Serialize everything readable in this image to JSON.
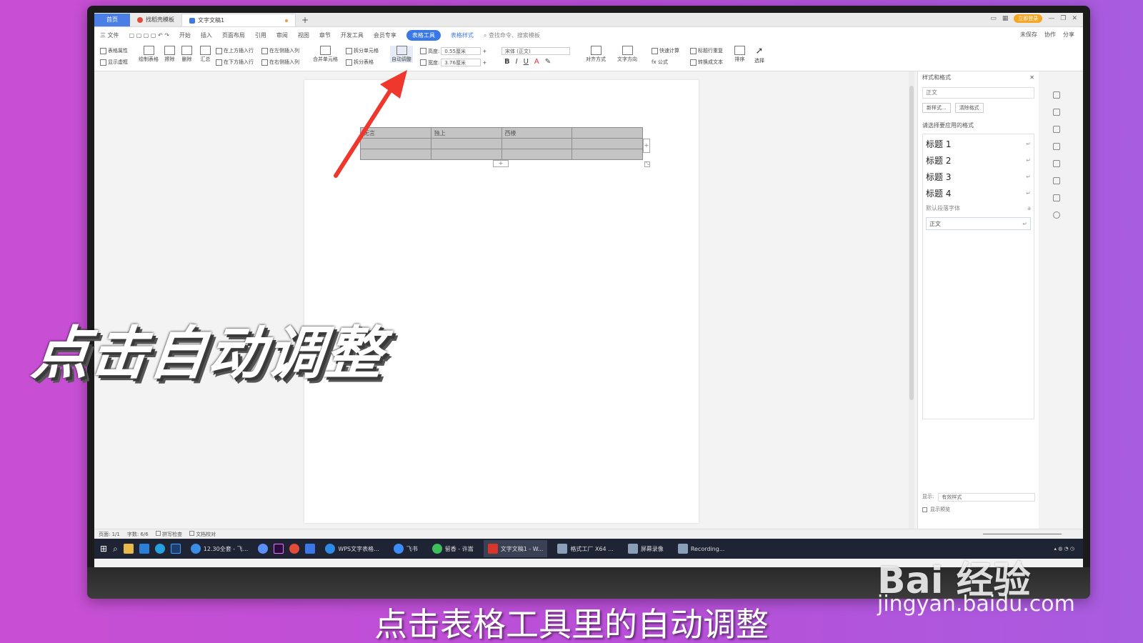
{
  "titlebar": {
    "tabs": [
      {
        "label": "首页"
      },
      {
        "label": "找稻壳模板"
      },
      {
        "label": "文字文稿1"
      }
    ],
    "login": "立即登录"
  },
  "menubar": {
    "items": [
      "三 文件",
      "开始",
      "插入",
      "页面布局",
      "引用",
      "审阅",
      "视图",
      "章节",
      "开发工具",
      "会员专享"
    ],
    "active": "表格工具",
    "style_tab": "表格样式",
    "search": "查找命令、搜索模板",
    "right": [
      "未保存",
      "协作",
      "分享"
    ]
  },
  "ribbon": {
    "table_props": "表格属性",
    "show_gridlines": "显示虚框",
    "draw_table": "绘制表格",
    "erase": "擦除",
    "delete": "删除",
    "summary": "汇总",
    "insert_above": "在上方插入行",
    "insert_below": "在下方插入行",
    "insert_left": "在左侧插入列",
    "insert_right": "在右侧插入列",
    "merge": "合并单元格",
    "split_cell": "拆分单元格",
    "split_table": "拆分表格",
    "auto_fit": "自动调整",
    "height_label": "高度:",
    "height_value": "0.55厘米",
    "width_label": "宽度:",
    "width_value": "3.76厘米",
    "font": "宋体 (正文)",
    "align": "对齐方式",
    "text_dir": "文字方向",
    "quick_calc": "快速计算",
    "formula": "fx 公式",
    "repeat_header": "标题行重复",
    "convert_text": "转换成文本",
    "sort": "排序",
    "select": "选择"
  },
  "document": {
    "table": [
      [
        "无言",
        "独上",
        "西楼",
        ""
      ],
      [
        "",
        "",
        "",
        ""
      ],
      [
        "",
        "",
        "",
        ""
      ]
    ]
  },
  "style_panel": {
    "title": "样式和格式",
    "current": "正文",
    "new_style": "新样式...",
    "clear_format": "清除格式",
    "section": "请选择要应用的格式",
    "styles": [
      "标题 1",
      "标题 2",
      "标题 3",
      "标题 4"
    ],
    "default_font": "默认段落字体",
    "normal": "正文",
    "show_label": "显示:",
    "show_value": "有效样式",
    "preview": "显示预览"
  },
  "statusbar": {
    "page": "页面: 1/1",
    "words": "字数: 6/6",
    "spellcheck": "拼写检查",
    "proofread": "文档校对"
  },
  "taskbar": {
    "items": [
      "12.30全套 - 飞...",
      "WPS文字表格...",
      "飞书",
      "留香 - 许嵩",
      "文字文稿1 - W...",
      "格式工厂 X64 ...",
      "屏幕录像",
      "Recording..."
    ]
  },
  "overlay": {
    "caption": "点击自动调整",
    "subtitle": "点击表格工具里的自动调整",
    "watermark": "Bai 经验",
    "watermark_url": "jingyan.baidu.com"
  },
  "colors": {
    "accent": "#3a78e8",
    "arrow": "#f0372e",
    "background": "#c050d8"
  }
}
